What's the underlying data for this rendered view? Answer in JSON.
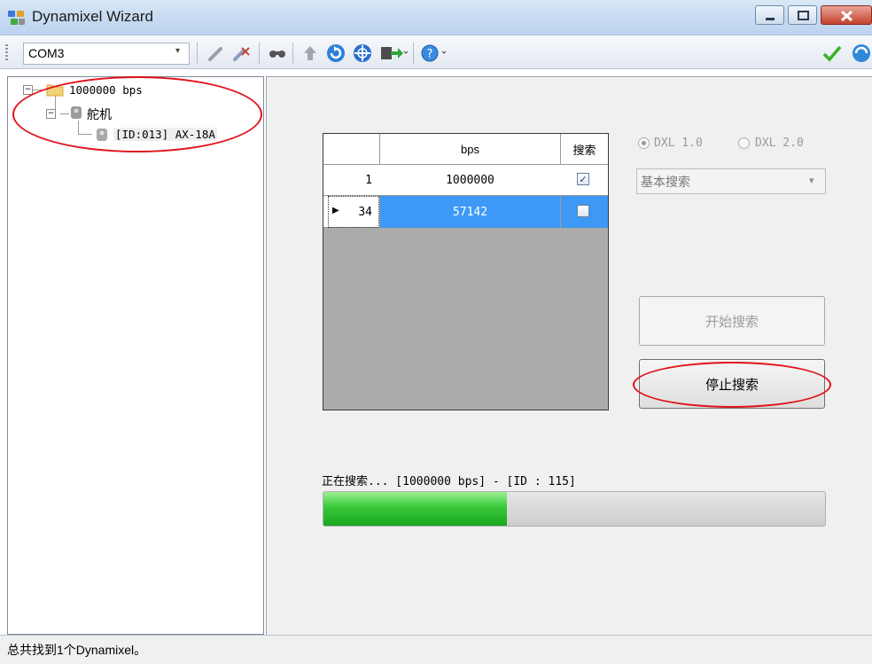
{
  "window": {
    "title": "Dynamixel Wizard",
    "min_glyph": "—",
    "max_glyph": "□",
    "close_glyph": "✕"
  },
  "toolbar": {
    "port": "COM3",
    "dropdown_glyph": "▾",
    "icons": [
      "wrench-icon",
      "disconnect-icon",
      "search-icon",
      "upload-icon",
      "refresh-icon",
      "target-icon",
      "download-icon",
      "help-icon",
      "check-icon",
      "sync-icon"
    ]
  },
  "tree": {
    "root": "1000000 bps",
    "group": "舵机",
    "device": "[ID:013] AX-18A",
    "expand_glyph": "−"
  },
  "grid": {
    "headers": [
      "bps",
      "搜索"
    ],
    "rows": [
      {
        "num": "1",
        "bps": "1000000",
        "checked": true,
        "selected": false
      },
      {
        "num": "34",
        "bps": "57142",
        "checked": false,
        "selected": true
      }
    ],
    "row_marker": "▶",
    "check_glyph": "✓"
  },
  "protocol": {
    "options": [
      "DXL 1.0",
      "DXL 2.0"
    ],
    "selected": "DXL 1.0"
  },
  "search_mode": {
    "value": "基本搜索",
    "arrow": "▾"
  },
  "buttons": {
    "start": "开始搜索",
    "stop": "停止搜索"
  },
  "status": {
    "text": "正在搜索... [1000000 bps] - [ID : 115]",
    "progress_fraction": 0.366
  },
  "statusbar": {
    "text": "总共找到1个Dynamixel。"
  },
  "colors": {
    "selection": "#3d99f5",
    "annotation": "#e0121a",
    "progress": "#38c93a"
  }
}
